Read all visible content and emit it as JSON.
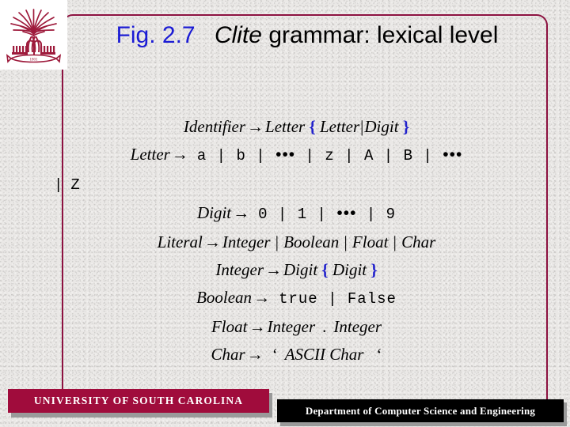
{
  "slide": {
    "title": {
      "figure_number": "Fig. 2.7",
      "language_name": "Clite",
      "rest": "grammar: lexical level",
      "figure_number_color": "#1b1bd4",
      "text_color": "#000000"
    },
    "logo": {
      "name": "usc-palmetto-logo",
      "motto": "1801",
      "color": "#9e1b3c"
    },
    "frame_color": "#8c1140",
    "background_color": "#e9e7e5"
  },
  "grammar": {
    "arrow": "→",
    "bar": "|",
    "ellipsis": "•••",
    "brace_open": "{",
    "brace_close": "}",
    "brace_color": "#2222cc",
    "rules": [
      {
        "lhs": "Identifier",
        "rhs_text": "Letter { Letter | Digit }",
        "align": "center"
      },
      {
        "lhs": "Letter",
        "rhs_text": "a | b | ••• | z | A | B | •••",
        "align": "center"
      },
      {
        "lhs": "",
        "rhs_text": "| Z",
        "align": "left",
        "continuation": true
      },
      {
        "lhs": "Digit",
        "rhs_text": "0 | 1 | ••• | 9",
        "align": "center"
      },
      {
        "lhs": "Literal",
        "rhs_text": "Integer | Boolean | Float | Char",
        "align": "center"
      },
      {
        "lhs": "Integer",
        "rhs_text": "Digit { Digit }",
        "align": "center"
      },
      {
        "lhs": "Boolean",
        "rhs_text": "true | False",
        "align": "center"
      },
      {
        "lhs": "Float",
        "rhs_text": "Integer . Integer",
        "align": "center"
      },
      {
        "lhs": "Char",
        "rhs_text": "‘ ASCII Char ‘",
        "align": "center"
      }
    ],
    "terminals": {
      "letters_lower": [
        "a",
        "b",
        "z"
      ],
      "letters_upper": [
        "A",
        "B",
        "Z"
      ],
      "digits": [
        "0",
        "1",
        "9"
      ],
      "booleans": [
        "true",
        "False"
      ],
      "quote": "‘",
      "ascii_char": "ASCII Char",
      "dot": "."
    }
  },
  "footer": {
    "university_bar": {
      "label": "UNIVERSITY OF SOUTH CAROLINA",
      "background": "#a00c3c",
      "text_color": "#ffffff"
    },
    "department_bar": {
      "label": "Department of Computer Science and Engineering",
      "background": "#000000",
      "text_color": "#ffffff"
    }
  }
}
